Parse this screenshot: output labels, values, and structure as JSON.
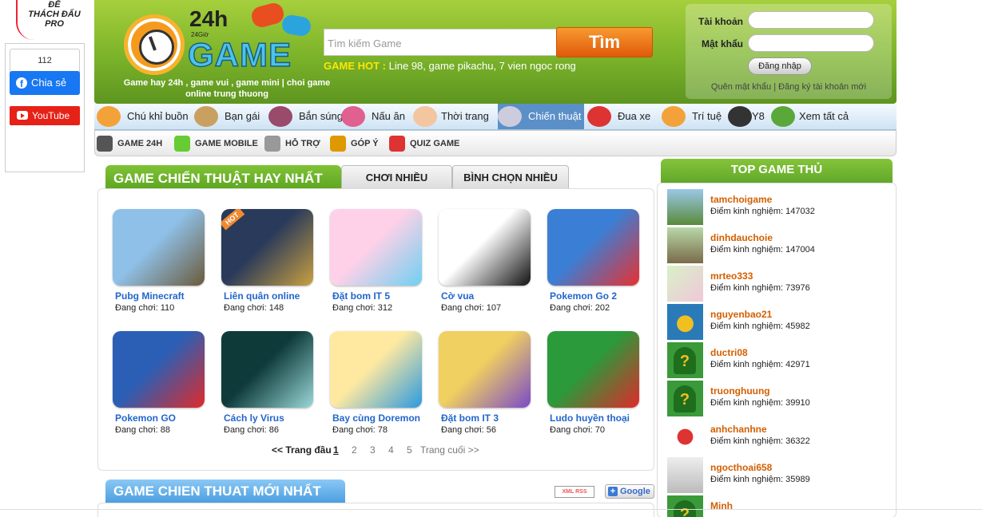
{
  "promo": {
    "line1": "ĐỂ",
    "line2": "THÁCH ĐẤU",
    "line3": "PRO"
  },
  "social": {
    "fb_count": "112",
    "fb_label": "Chia sẻ",
    "yt_label": "YouTube"
  },
  "header": {
    "logo_24": "24h",
    "logo_sub": "24Giờ",
    "logo_game": "GAME",
    "slogan": "Game hay 24h , game vui , game mini | choi game online trung thuong",
    "search_placeholder": "Tìm kiếm Game",
    "search_button": "Tìm",
    "hot_label": "GAME HOT :",
    "hot_text": "Line 98, game pikachu, 7 vien ngoc rong",
    "login": {
      "user_label": "Tài khoản",
      "pass_label": "Mật khẩu",
      "button": "Đăng nhập",
      "forgot": "Quên mật khẩu",
      "sep": "|",
      "register": "Đăng ký tài khoản mới"
    }
  },
  "categories": [
    {
      "label": "Chú khỉ buồn",
      "icon": "monkey-icon",
      "color": "#f3a23a"
    },
    {
      "label": "Bạn gái",
      "icon": "girl-icon",
      "color": "#c9a060"
    },
    {
      "label": "Bắn súng",
      "icon": "shooter-icon",
      "color": "#9a4a6a"
    },
    {
      "label": "Nấu ăn",
      "icon": "cook-icon",
      "color": "#e06090"
    },
    {
      "label": "Thời trang",
      "icon": "fashion-icon",
      "color": "#f3c6a0"
    },
    {
      "label": "Chiến thuật",
      "icon": "sword-icon",
      "color": "#ccd"
    },
    {
      "label": "Đua xe",
      "icon": "car-icon",
      "color": "#d33"
    },
    {
      "label": "Trí tuệ",
      "icon": "brain-icon",
      "color": "#f3a23a"
    },
    {
      "label": "Y8",
      "icon": "y8-icon",
      "color": "#333"
    },
    {
      "label": "Xem tất cả",
      "icon": "arrow-down-icon",
      "color": "#5aa83a"
    }
  ],
  "subnav": [
    {
      "label": "GAME 24H",
      "icon": "gamepad-icon"
    },
    {
      "label": "GAME MOBILE",
      "icon": "mobile-icon"
    },
    {
      "label": "HỖ TRỢ",
      "icon": "tools-icon"
    },
    {
      "label": "GÓP Ý",
      "icon": "pen-icon"
    },
    {
      "label": "QUIZ GAME",
      "icon": "quiz-icon"
    }
  ],
  "main": {
    "title": "GAME CHIẾN THUẬT HAY NHẤT",
    "tab_most_played": "CHƠI NHIỀU",
    "tab_most_voted": "BÌNH CHỌN NHIỀU",
    "playing_label": "Đang chơi:",
    "games": [
      {
        "name": "Pubg Minecraft",
        "playing": "110",
        "colors": [
          "#8fc0e8",
          "#6b5a3a"
        ]
      },
      {
        "name": "Liên quân online",
        "playing": "148",
        "colors": [
          "#2a3a5a",
          "#c9a040"
        ],
        "badge": "HOT"
      },
      {
        "name": "Đặt bom IT 5",
        "playing": "312",
        "colors": [
          "#ffd1e8",
          "#6fd0f0"
        ]
      },
      {
        "name": "Cờ vua",
        "playing": "107",
        "colors": [
          "#ffffff",
          "#111111"
        ]
      },
      {
        "name": "Pokemon Go 2",
        "playing": "202",
        "colors": [
          "#3a7fd5",
          "#e83030"
        ]
      },
      {
        "name": "Pokemon GO",
        "playing": "88",
        "colors": [
          "#2a5fb5",
          "#e02a2a"
        ]
      },
      {
        "name": "Cách ly Virus",
        "playing": "86",
        "colors": [
          "#0e3a3a",
          "#9ad8d8"
        ]
      },
      {
        "name": "Bay cùng Doremon",
        "playing": "78",
        "colors": [
          "#ffe9a0",
          "#2a9ae0"
        ]
      },
      {
        "name": "Đặt bom IT 3",
        "playing": "56",
        "colors": [
          "#f0d060",
          "#7a4ac8"
        ]
      },
      {
        "name": "Ludo huyền thoại",
        "playing": "70",
        "colors": [
          "#2a9a3a",
          "#e02a2a"
        ]
      }
    ],
    "pager": {
      "first": "<< Trang đầu",
      "pages": [
        "1",
        "2",
        "3",
        "4",
        "5"
      ],
      "last": "Trang cuối >>"
    }
  },
  "new_section": {
    "title": "GAME CHIEN THUAT MỚI NHẤT",
    "rss": "XML RSS",
    "google": "Google"
  },
  "top_players": {
    "title": "TOP GAME THỦ",
    "score_label": "Điểm kinh nghiệm:",
    "players": [
      {
        "name": "tamchoigame",
        "score": "147032",
        "avatar": "landscape"
      },
      {
        "name": "dinhdauchoie",
        "score": "147004",
        "avatar": "landscape2"
      },
      {
        "name": "mrteo333",
        "score": "73976",
        "avatar": "flowers"
      },
      {
        "name": "nguyenbao21",
        "score": "45982",
        "avatar": "fish"
      },
      {
        "name": "ductri08",
        "score": "42971",
        "avatar": "unknown"
      },
      {
        "name": "truonghuung",
        "score": "39910",
        "avatar": "unknown"
      },
      {
        "name": "anhchanhne",
        "score": "36322",
        "avatar": "logo"
      },
      {
        "name": "ngocthoai658",
        "score": "35989",
        "avatar": "face"
      },
      {
        "name": "Minh",
        "score": "",
        "avatar": "unknown"
      }
    ]
  }
}
